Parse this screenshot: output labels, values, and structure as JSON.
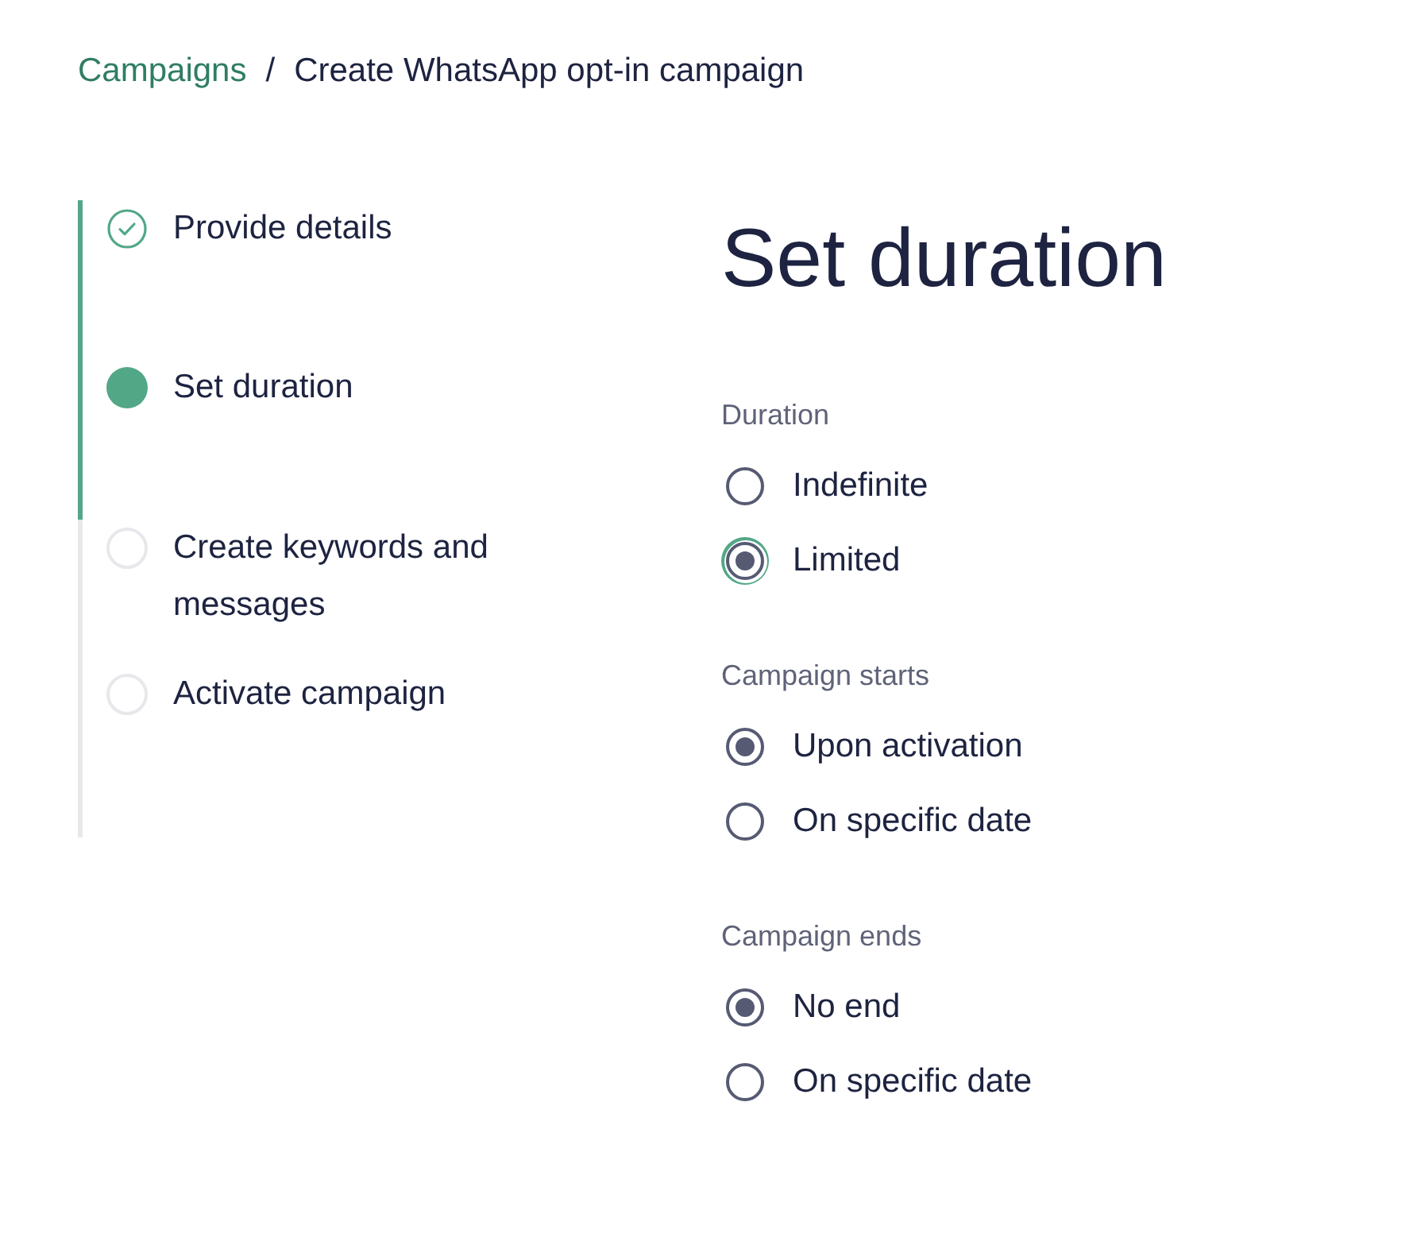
{
  "breadcrumb": {
    "link": "Campaigns",
    "separator": "/",
    "current": "Create WhatsApp opt-in campaign"
  },
  "steps": [
    {
      "label": "Provide details",
      "kind": "done"
    },
    {
      "label": "Set duration",
      "kind": "current"
    },
    {
      "label": "Create keywords and messages",
      "kind": "todo"
    },
    {
      "label": "Activate campaign",
      "kind": "todo"
    }
  ],
  "title": "Set duration",
  "groups": [
    {
      "label": "Duration",
      "options": [
        {
          "label": "Indefinite",
          "selected": false,
          "focused": false
        },
        {
          "label": "Limited",
          "selected": true,
          "focused": true
        }
      ]
    },
    {
      "label": "Campaign starts",
      "options": [
        {
          "label": "Upon activation",
          "selected": true,
          "focused": false
        },
        {
          "label": "On specific date",
          "selected": false,
          "focused": false
        }
      ]
    },
    {
      "label": "Campaign ends",
      "options": [
        {
          "label": "No end",
          "selected": true,
          "focused": false
        },
        {
          "label": "On specific date",
          "selected": false,
          "focused": false
        }
      ]
    }
  ]
}
